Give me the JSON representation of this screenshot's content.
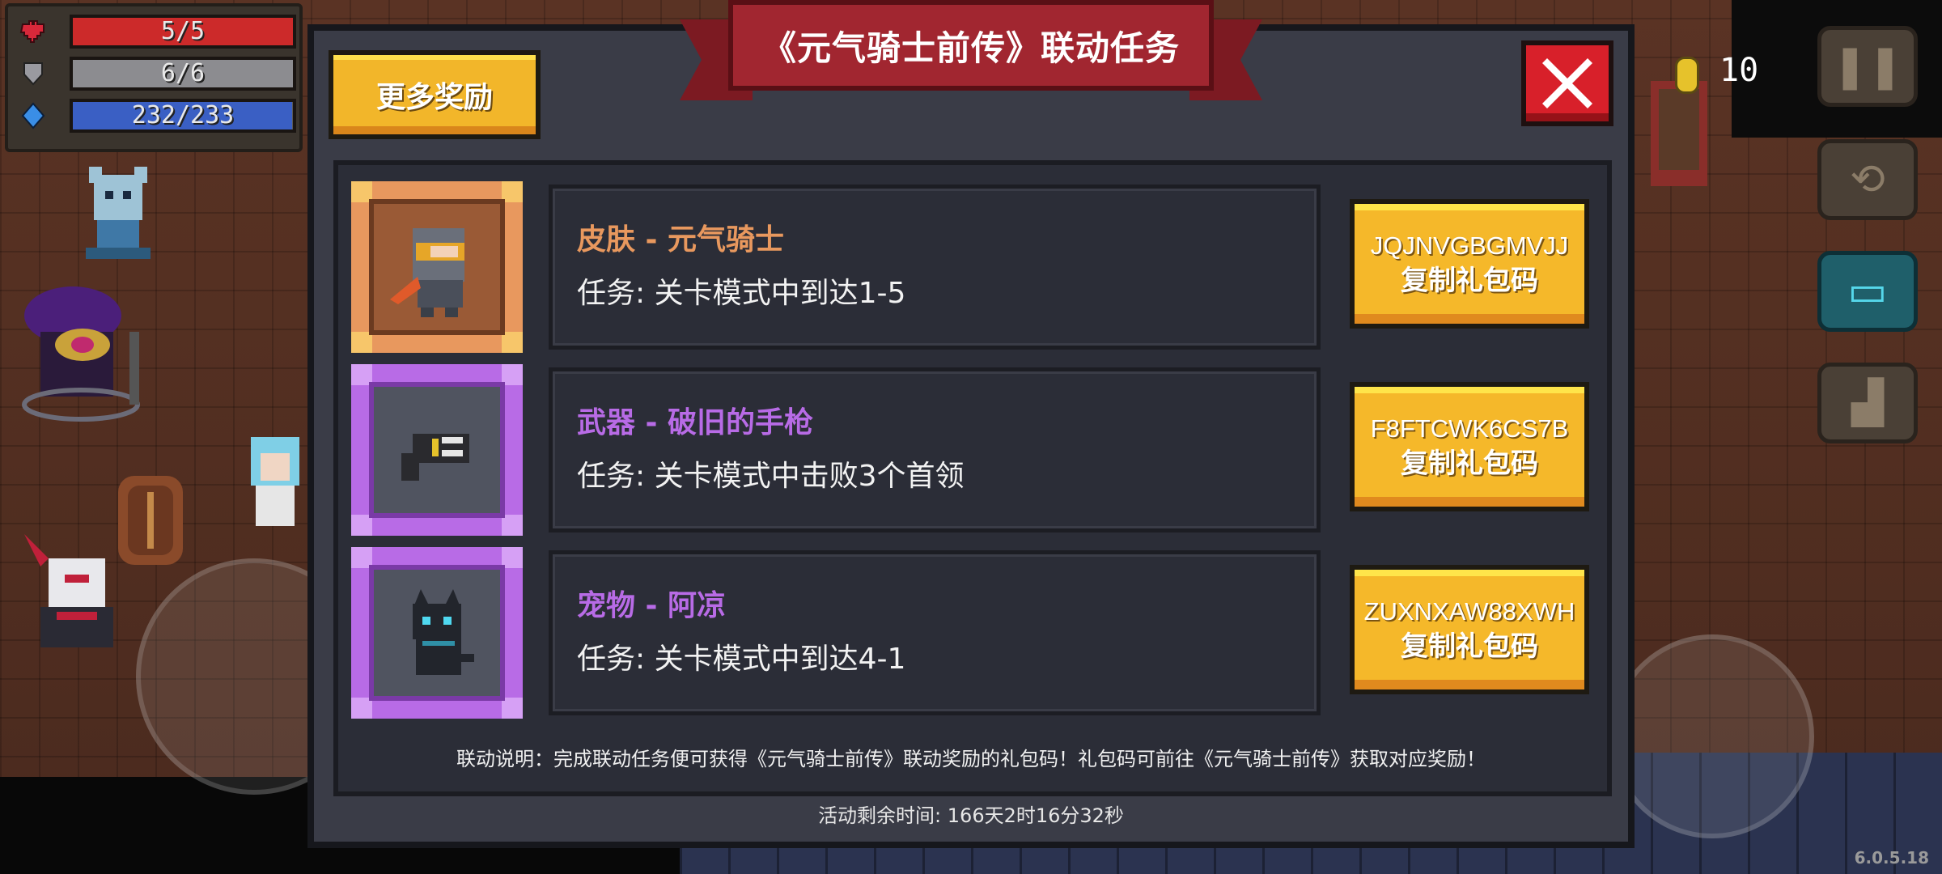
{
  "hud": {
    "hp": "5/5",
    "armor": "6/6",
    "energy": "232/233",
    "coins": "10",
    "version": "6.0.5.18",
    "icons": [
      "heart-icon",
      "shield-icon",
      "energy-crystal-icon",
      "coin-icon",
      "pause-icon",
      "swap-weapon-icon",
      "chat-icon",
      "emote-icon"
    ]
  },
  "dialog": {
    "title": "《元气骑士前传》联动任务",
    "more_rewards": "更多奖励",
    "tasks": [
      {
        "title": "皮肤 - 元气骑士",
        "desc": "任务: 关卡模式中到达1-5",
        "code": "JQJNVGBGMVJJ",
        "copy_label": "复制礼包码",
        "rarity_color": "#e8985e",
        "icon": "knight-skin-icon"
      },
      {
        "title": "武器 - 破旧的手枪",
        "desc": "任务: 关卡模式中击败3个首领",
        "code": "F8FTCWK6CS7B",
        "copy_label": "复制礼包码",
        "rarity_color": "#b86be6",
        "icon": "pistol-icon"
      },
      {
        "title": "宠物 - 阿凉",
        "desc": "任务: 关卡模式中到达4-1",
        "code": "ZUXNXAW88XWH",
        "copy_label": "复制礼包码",
        "rarity_color": "#b86be6",
        "icon": "black-cat-pet-icon"
      }
    ],
    "note": "联动说明：完成联动任务便可获得《元气骑士前传》联动奖励的礼包码！礼包码可前往《元气骑士前传》获取对应奖励！",
    "timer": "活动剩余时间: 166天2时16分32秒"
  }
}
